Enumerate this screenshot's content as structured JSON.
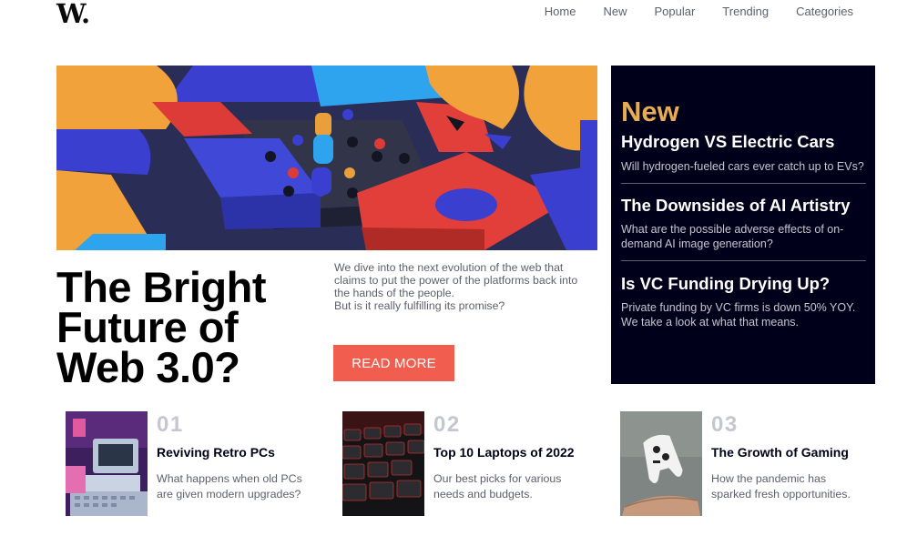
{
  "logo": "W.",
  "nav": {
    "items": [
      "Home",
      "New",
      "Popular",
      "Trending",
      "Categories"
    ]
  },
  "hero": {
    "title": "The Bright Future of Web 3.0?",
    "description_line1": "We dive into the next evolution of the web that claims to put the power of the platforms back into the hands of the people.",
    "description_line2": "But is it really fulfilling its promise?",
    "button": "READ MORE"
  },
  "new_section": {
    "heading": "New",
    "items": [
      {
        "title": "Hydrogen VS Electric Cars",
        "desc": "Will hydrogen-fueled cars ever catch up to EVs?"
      },
      {
        "title": "The Downsides of AI Artistry",
        "desc": "What are the possible adverse effects of on-demand AI image generation?"
      },
      {
        "title": "Is VC Funding Drying Up?",
        "desc": "Private funding by VC firms is down 50% YOY. We take a look at what that means."
      }
    ]
  },
  "cards": [
    {
      "num": "01",
      "title": "Reviving Retro PCs",
      "desc": "What happens when old PCs are given modern upgrades?"
    },
    {
      "num": "02",
      "title": "Top 10 Laptops of 2022",
      "desc": "Our best picks for various needs and budgets."
    },
    {
      "num": "03",
      "title": "The Growth of Gaming",
      "desc": "How the pandemic has sparked fresh opportunities."
    }
  ],
  "colors": {
    "accent_red": "#f15e50",
    "accent_orange": "#e9ab53",
    "dark_navy": "#00001a",
    "gray_text": "#5d5f6d",
    "light_gray": "#c5c6d0"
  }
}
